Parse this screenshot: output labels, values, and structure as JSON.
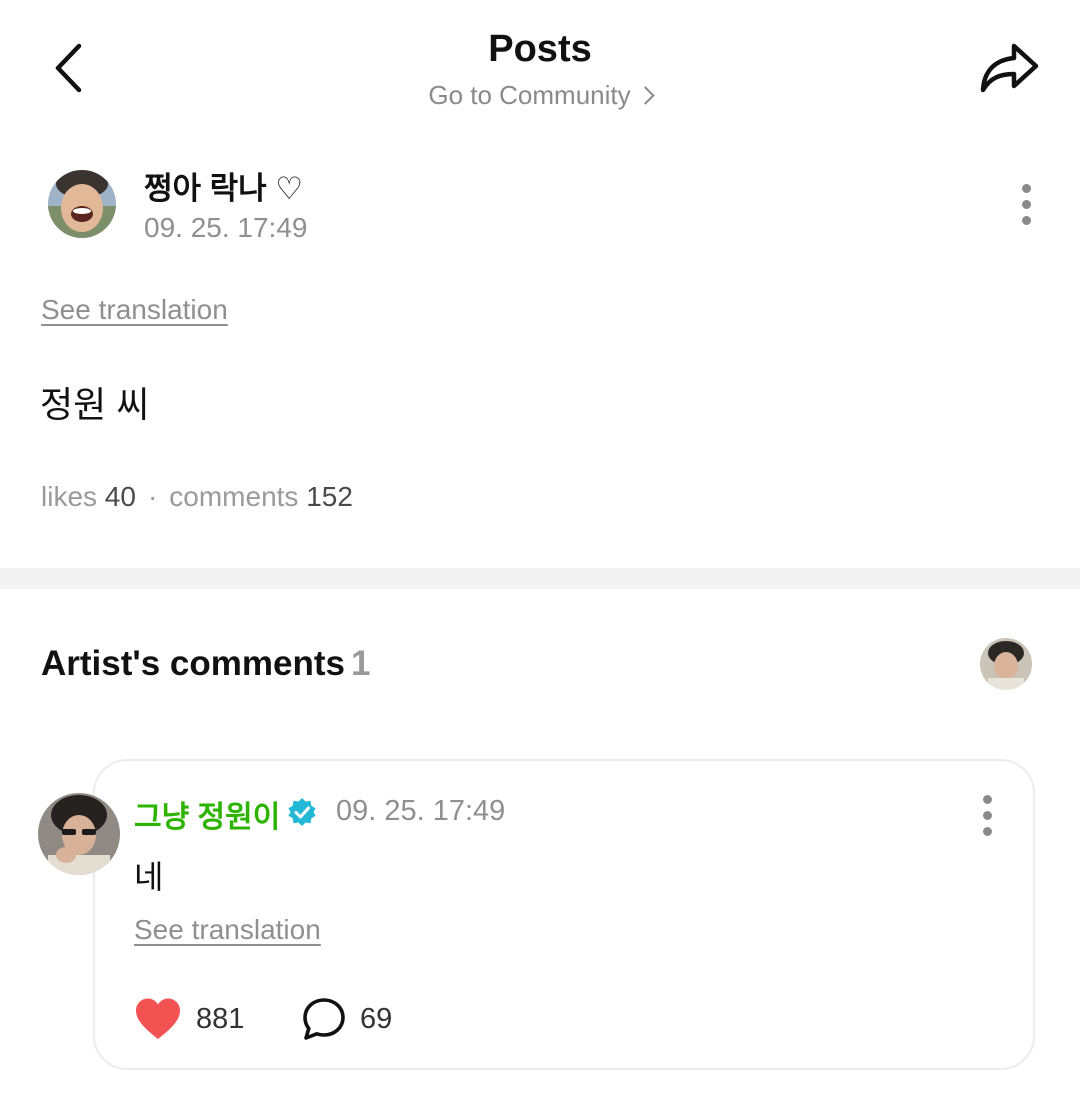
{
  "header": {
    "title": "Posts",
    "community_link": "Go to Community"
  },
  "post": {
    "author": "쩡아 락나 ♡",
    "date": "09. 25. 17:49",
    "see_translation": "See translation",
    "body": "정원 씨",
    "likes_label": "likes",
    "likes_count": "40",
    "separator": "·",
    "comments_label": "comments",
    "comments_count": "152"
  },
  "artist_section": {
    "title": "Artist's comments",
    "count": "1"
  },
  "artist_comment": {
    "author": "그냥 정원이",
    "date": "09. 25. 17:49",
    "body": "네",
    "see_translation": "See translation",
    "like_count": "881",
    "reply_count": "69"
  },
  "colors": {
    "artist_name": "#2db400",
    "verified_badge": "#22b8d6",
    "heart": "#f25252",
    "muted_text": "#8f8f8f",
    "divider": "#f3f3f3"
  },
  "icons": {
    "back": "chevron-left-icon",
    "share": "share-arrow-icon",
    "more": "kebab-menu-icon",
    "verified": "verified-badge-icon",
    "like": "heart-icon",
    "reply": "speech-bubble-icon"
  }
}
